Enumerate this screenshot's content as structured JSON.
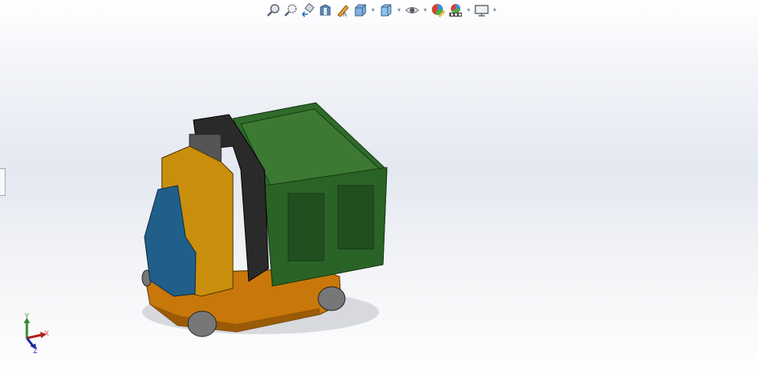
{
  "toolbar": {
    "items": [
      {
        "icon": "zoom-to-fit-icon"
      },
      {
        "icon": "zoom-to-area-icon"
      },
      {
        "icon": "previous-view-icon"
      },
      {
        "icon": "section-view-icon"
      },
      {
        "icon": "dynamic-annotation-views-icon"
      },
      {
        "icon": "view-orientation-icon",
        "dropdown": true
      },
      {
        "icon": "display-style-icon",
        "dropdown": true
      },
      {
        "icon": "hide-show-items-icon",
        "dropdown": true
      },
      {
        "icon": "edit-appearance-icon"
      },
      {
        "icon": "apply-scene-icon",
        "dropdown": true
      },
      {
        "icon": "view-settings-icon",
        "dropdown": true
      }
    ]
  },
  "triad": {
    "x_label": "X",
    "y_label": "Y",
    "z_label": "Z"
  },
  "colors": {
    "crate": "#2f6b2a",
    "base": "#c8780a",
    "seat": "#c98e0b",
    "backrest": "#1f5f8a",
    "frame": "#2a2a2a"
  }
}
